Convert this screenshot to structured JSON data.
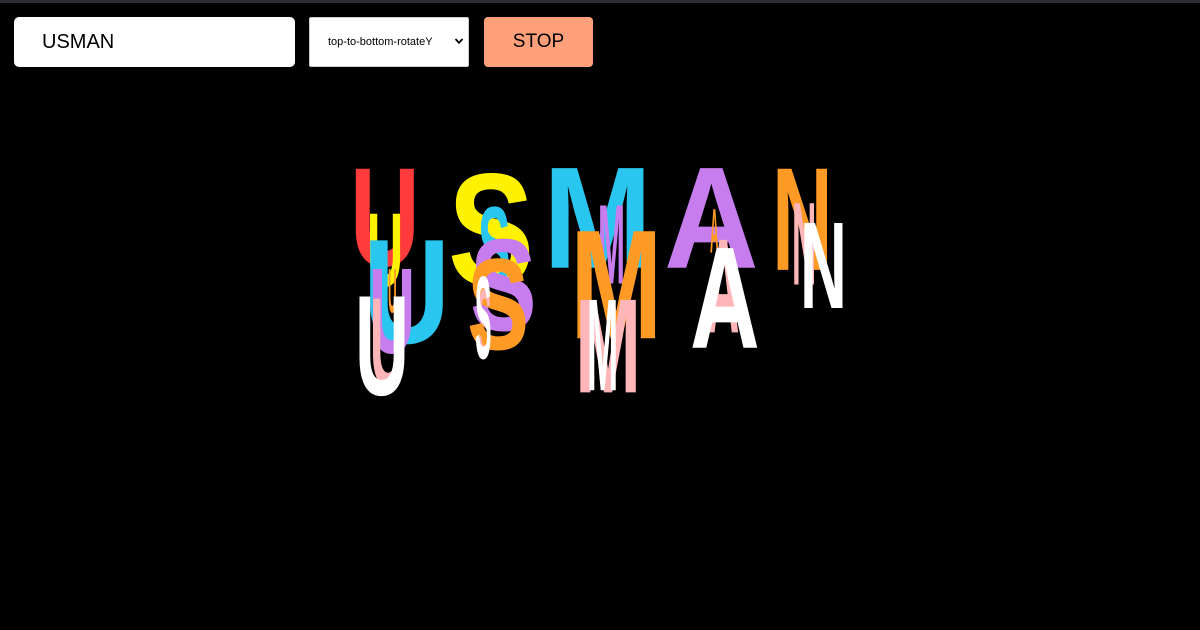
{
  "controls": {
    "text_value": "USMAN",
    "animation_selected": "top-to-bottom-rotateY",
    "stop_label": "STOP"
  },
  "colors": {
    "page_background": "#000000",
    "stop_button": "#ffa07a",
    "letter_palette": [
      "#ff3b3b",
      "#fff200",
      "#29c6f0",
      "#c77dee",
      "#ff9b25",
      "#ffb6b9",
      "#ffffff"
    ]
  },
  "animation": {
    "word": "USMAN",
    "layers": [
      {
        "color": "#ff3b3b",
        "letters": [
          "U"
        ]
      },
      {
        "color": "#fff200",
        "letters": [
          "U",
          "S"
        ]
      },
      {
        "color": "#29c6f0",
        "letters": [
          "U",
          "S",
          "M"
        ]
      },
      {
        "color": "#c77dee",
        "letters": [
          "U",
          "S",
          "M",
          "A"
        ]
      },
      {
        "color": "#ff9b25",
        "letters": [
          "U",
          "S",
          "M",
          "A",
          "N"
        ]
      },
      {
        "color": "#ffb6b9",
        "letters": [
          "U",
          "S",
          "M",
          "A",
          "N"
        ]
      },
      {
        "color": "#ffffff",
        "letters": [
          "U",
          "S",
          "M",
          "A",
          "N"
        ]
      }
    ]
  }
}
